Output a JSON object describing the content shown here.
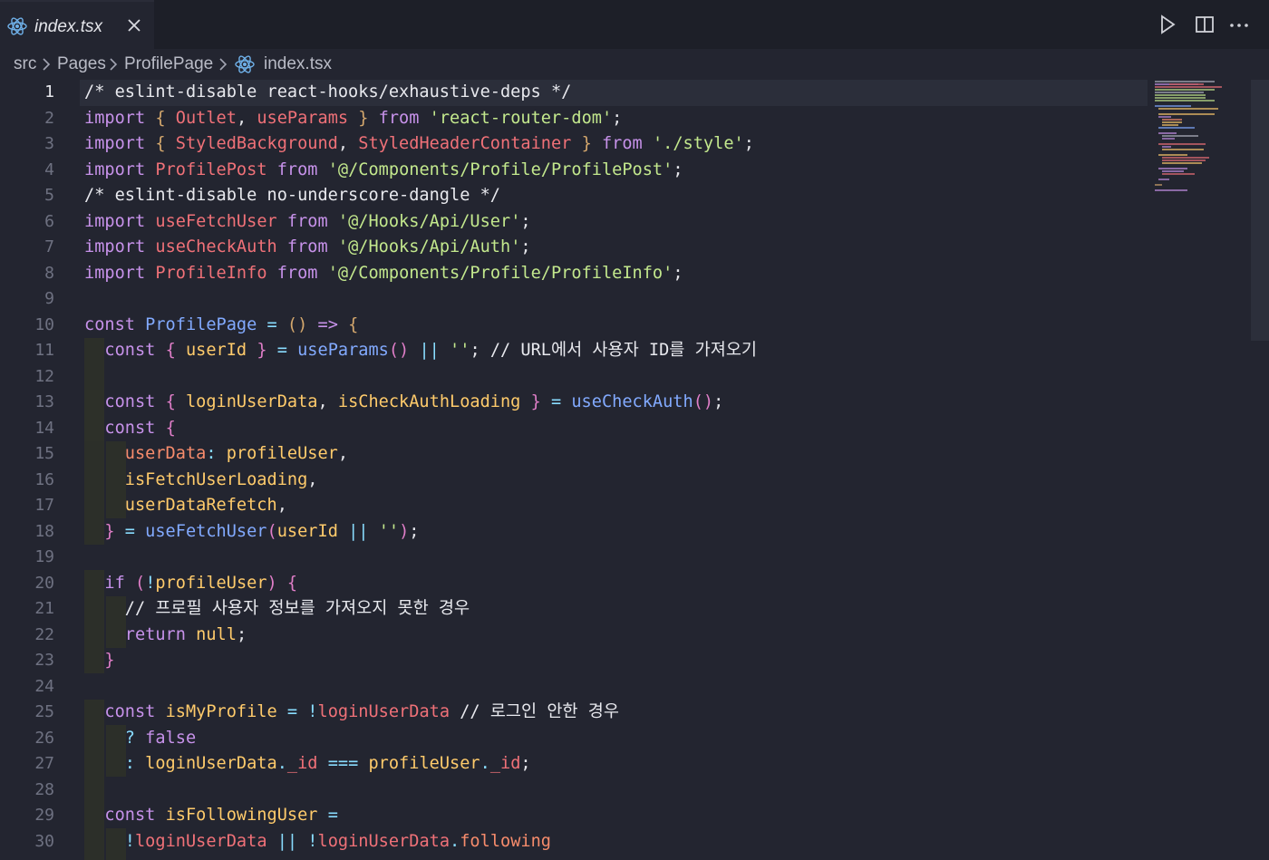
{
  "tab": {
    "filename": "index.tsx",
    "file_icon": "react-icon"
  },
  "actions": [
    "run-icon",
    "split-editor-icon",
    "more-actions-icon"
  ],
  "breadcrumb": [
    "src",
    "Pages",
    "ProfilePage",
    "index.tsx"
  ],
  "editor": {
    "active_line": 1,
    "lines": [
      {
        "n": "1",
        "tokens": [
          [
            "cm",
            "/* eslint-disable react-hooks/exhaustive-deps */"
          ]
        ]
      },
      {
        "n": "2",
        "tokens": [
          [
            "kw",
            "import "
          ],
          [
            "br2",
            "{ "
          ],
          [
            "vr",
            "Outlet"
          ],
          [
            "pl",
            ", "
          ],
          [
            "vr",
            "useParams"
          ],
          [
            "br2",
            " } "
          ],
          [
            "kw",
            "from "
          ],
          [
            "st",
            "'react-router-dom'"
          ],
          [
            "pl",
            ";"
          ]
        ]
      },
      {
        "n": "3",
        "tokens": [
          [
            "kw",
            "import "
          ],
          [
            "br2",
            "{ "
          ],
          [
            "vr",
            "StyledBackground"
          ],
          [
            "pl",
            ", "
          ],
          [
            "vr",
            "StyledHeaderContainer"
          ],
          [
            "br2",
            " } "
          ],
          [
            "kw",
            "from "
          ],
          [
            "st",
            "'./style'"
          ],
          [
            "pl",
            ";"
          ]
        ]
      },
      {
        "n": "4",
        "tokens": [
          [
            "kw",
            "import "
          ],
          [
            "vr",
            "ProfilePost "
          ],
          [
            "kw",
            "from "
          ],
          [
            "st",
            "'@/Components/Profile/ProfilePost'"
          ],
          [
            "pl",
            ";"
          ]
        ]
      },
      {
        "n": "5",
        "tokens": [
          [
            "cm",
            "/* eslint-disable no-underscore-dangle */"
          ]
        ]
      },
      {
        "n": "6",
        "tokens": [
          [
            "kw",
            "import "
          ],
          [
            "vr",
            "useFetchUser "
          ],
          [
            "kw",
            "from "
          ],
          [
            "st",
            "'@/Hooks/Api/User'"
          ],
          [
            "pl",
            ";"
          ]
        ]
      },
      {
        "n": "7",
        "tokens": [
          [
            "kw",
            "import "
          ],
          [
            "vr",
            "useCheckAuth "
          ],
          [
            "kw",
            "from "
          ],
          [
            "st",
            "'@/Hooks/Api/Auth'"
          ],
          [
            "pl",
            ";"
          ]
        ]
      },
      {
        "n": "8",
        "tokens": [
          [
            "kw",
            "import "
          ],
          [
            "vr",
            "ProfileInfo "
          ],
          [
            "kw",
            "from "
          ],
          [
            "st",
            "'@/Components/Profile/ProfileInfo'"
          ],
          [
            "pl",
            ";"
          ]
        ]
      },
      {
        "n": "9",
        "tokens": []
      },
      {
        "n": "10",
        "tokens": [
          [
            "kw",
            "const "
          ],
          [
            "fn",
            "ProfilePage "
          ],
          [
            "op",
            "= "
          ],
          [
            "br2",
            "() "
          ],
          [
            "kw",
            "=> "
          ],
          [
            "br2",
            "{"
          ]
        ]
      },
      {
        "n": "11",
        "tokens": [
          [
            "pl",
            "  "
          ],
          [
            "kw",
            "const "
          ],
          [
            "br",
            "{ "
          ],
          [
            "pr",
            "userId "
          ],
          [
            "br",
            "} "
          ],
          [
            "op",
            "= "
          ],
          [
            "fn",
            "useParams"
          ],
          [
            "br",
            "() "
          ],
          [
            "op",
            "|| "
          ],
          [
            "st",
            "''"
          ],
          [
            "pl",
            "; "
          ],
          [
            "cm",
            "// URL에서 사용자 ID를 가져오기"
          ]
        ]
      },
      {
        "n": "12",
        "tokens": []
      },
      {
        "n": "13",
        "tokens": [
          [
            "pl",
            "  "
          ],
          [
            "kw",
            "const "
          ],
          [
            "br",
            "{ "
          ],
          [
            "pr",
            "loginUserData"
          ],
          [
            "pl",
            ", "
          ],
          [
            "pr",
            "isCheckAuthLoading "
          ],
          [
            "br",
            "} "
          ],
          [
            "op",
            "= "
          ],
          [
            "fn",
            "useCheckAuth"
          ],
          [
            "br",
            "()"
          ],
          [
            "pl",
            ";"
          ]
        ]
      },
      {
        "n": "14",
        "tokens": [
          [
            "pl",
            "  "
          ],
          [
            "kw",
            "const "
          ],
          [
            "br",
            "{"
          ]
        ]
      },
      {
        "n": "15",
        "tokens": [
          [
            "pl",
            "    "
          ],
          [
            "bl",
            "userData"
          ],
          [
            "op",
            ": "
          ],
          [
            "pr",
            "profileUser"
          ],
          [
            "pl",
            ","
          ]
        ]
      },
      {
        "n": "16",
        "tokens": [
          [
            "pl",
            "    "
          ],
          [
            "pr",
            "isFetchUserLoading"
          ],
          [
            "pl",
            ","
          ]
        ]
      },
      {
        "n": "17",
        "tokens": [
          [
            "pl",
            "    "
          ],
          [
            "pr",
            "userDataRefetch"
          ],
          [
            "pl",
            ","
          ]
        ]
      },
      {
        "n": "18",
        "tokens": [
          [
            "pl",
            "  "
          ],
          [
            "br",
            "} "
          ],
          [
            "op",
            "= "
          ],
          [
            "fn",
            "useFetchUser"
          ],
          [
            "br",
            "("
          ],
          [
            "pr",
            "userId "
          ],
          [
            "op",
            "|| "
          ],
          [
            "st",
            "''"
          ],
          [
            "br",
            ")"
          ],
          [
            "pl",
            ";"
          ]
        ]
      },
      {
        "n": "19",
        "tokens": []
      },
      {
        "n": "20",
        "tokens": [
          [
            "pl",
            "  "
          ],
          [
            "kw",
            "if "
          ],
          [
            "br",
            "("
          ],
          [
            "op",
            "!"
          ],
          [
            "pr",
            "profileUser"
          ],
          [
            "br",
            ") {"
          ]
        ]
      },
      {
        "n": "21",
        "tokens": [
          [
            "pl",
            "    "
          ],
          [
            "cm",
            "// 프로필 사용자 정보를 가져오지 못한 경우"
          ]
        ]
      },
      {
        "n": "22",
        "tokens": [
          [
            "pl",
            "    "
          ],
          [
            "kw",
            "return "
          ],
          [
            "pr",
            "null"
          ],
          [
            "pl",
            ";"
          ]
        ]
      },
      {
        "n": "23",
        "tokens": [
          [
            "pl",
            "  "
          ],
          [
            "br",
            "}"
          ]
        ]
      },
      {
        "n": "24",
        "tokens": []
      },
      {
        "n": "25",
        "tokens": [
          [
            "pl",
            "  "
          ],
          [
            "kw",
            "const "
          ],
          [
            "pr",
            "isMyProfile "
          ],
          [
            "op",
            "= !"
          ],
          [
            "vr",
            "loginUserData "
          ],
          [
            "cm",
            "// 로그인 안한 경우"
          ]
        ]
      },
      {
        "n": "26",
        "tokens": [
          [
            "pl",
            "    "
          ],
          [
            "op",
            "? "
          ],
          [
            "kw",
            "false"
          ]
        ]
      },
      {
        "n": "27",
        "tokens": [
          [
            "pl",
            "    "
          ],
          [
            "op",
            ": "
          ],
          [
            "pr",
            "loginUserData"
          ],
          [
            "op",
            "."
          ],
          [
            "vr",
            "_id "
          ],
          [
            "op",
            "=== "
          ],
          [
            "pr",
            "profileUser"
          ],
          [
            "op",
            "."
          ],
          [
            "vr",
            "_id"
          ],
          [
            "pl",
            ";"
          ]
        ]
      },
      {
        "n": "28",
        "tokens": []
      },
      {
        "n": "29",
        "tokens": [
          [
            "pl",
            "  "
          ],
          [
            "kw",
            "const "
          ],
          [
            "pr",
            "isFollowingUser "
          ],
          [
            "op",
            "="
          ]
        ]
      },
      {
        "n": "30",
        "tokens": [
          [
            "pl",
            "    "
          ],
          [
            "op",
            "!"
          ],
          [
            "vr",
            "loginUserData "
          ],
          [
            "op",
            "|| !"
          ],
          [
            "vr",
            "loginUserData"
          ],
          [
            "op",
            "."
          ],
          [
            "bl",
            "following"
          ]
        ]
      }
    ]
  }
}
